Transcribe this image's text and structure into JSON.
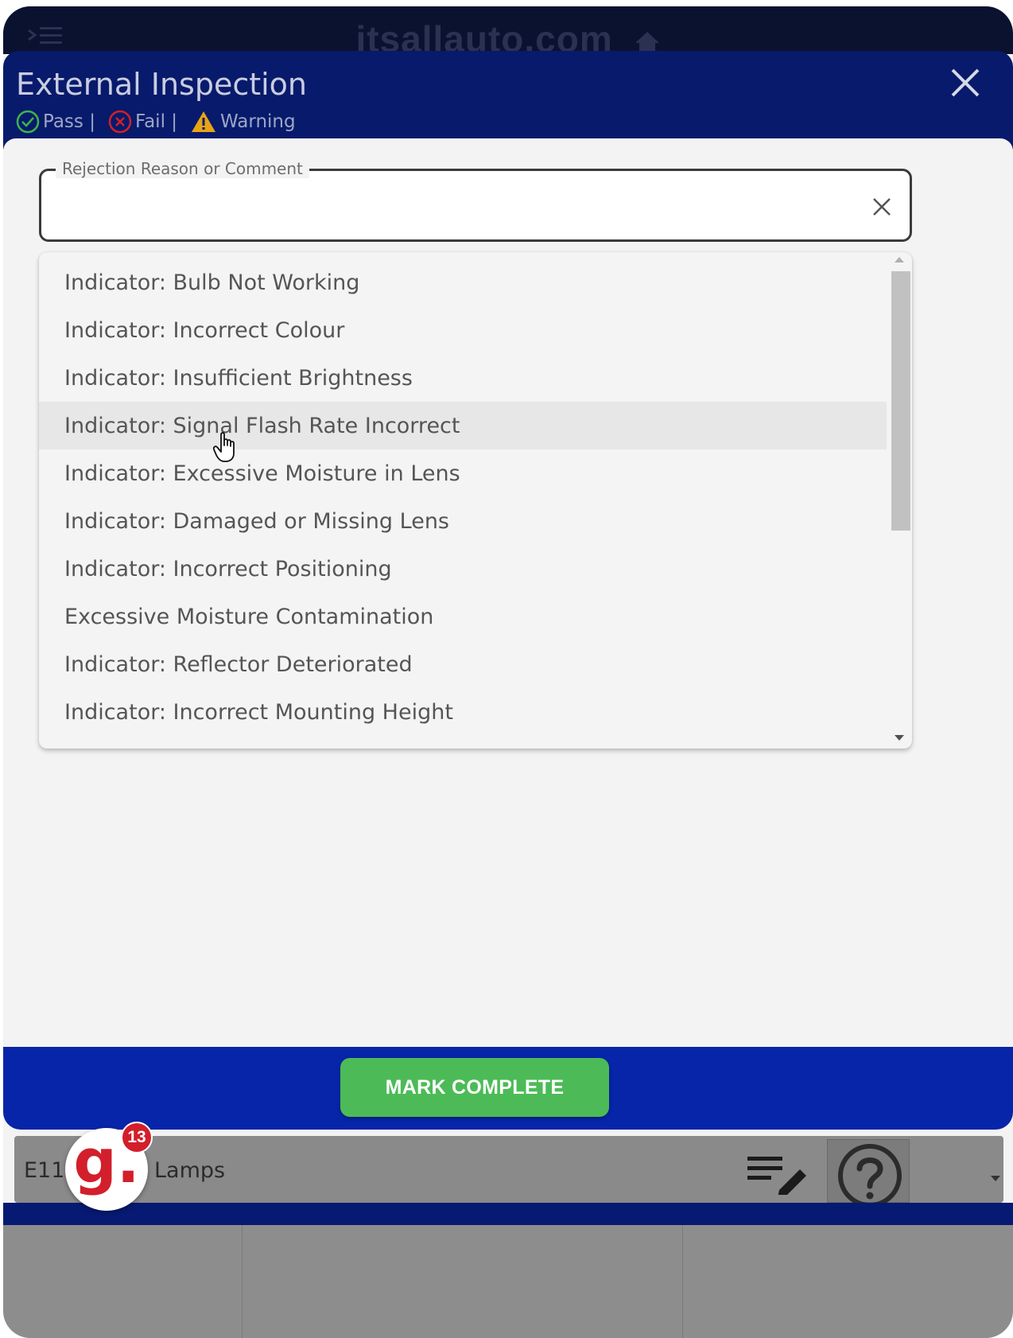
{
  "app": {
    "title": "itsallauto.com"
  },
  "modal": {
    "title": "External Inspection",
    "legend": {
      "pass": "Pass |",
      "fail": "Fail |",
      "warning": "Warning"
    }
  },
  "comment_field": {
    "label": "Rejection Reason or Comment",
    "value": ""
  },
  "options": [
    "Indicator: Bulb Not Working",
    "Indicator: Incorrect Colour",
    "Indicator: Insufficient Brightness",
    "Indicator: Signal Flash Rate Incorrect",
    "Indicator: Excessive Moisture in Lens",
    "Indicator: Damaged or Missing Lens",
    "Indicator: Incorrect Positioning",
    "Excessive Moisture Contamination",
    "Indicator: Reflector Deteriorated",
    "Indicator: Incorrect Mounting Height"
  ],
  "hovered_option": "Indicator: Signal Flash Rate Incorrect",
  "footer": {
    "mark_complete": "MARK COMPLETE"
  },
  "background_row": {
    "code": "E11.",
    "name": "Lamps"
  },
  "badge": {
    "letter": "g.",
    "count": "13"
  },
  "colors": {
    "header_bg": "#081a6b",
    "action_bar_bg": "#0625a8",
    "mark_complete_bg": "#4cbb57",
    "pass": "#3bb54a",
    "fail": "#d0202a",
    "warning": "#e8a317",
    "brand_red": "#d21f2b"
  },
  "icons": {
    "menu": "menu-icon",
    "home": "home-icon",
    "close": "close-icon",
    "pass": "check-circle-icon",
    "fail": "x-circle-icon",
    "warning": "warning-triangle-icon",
    "clear": "clear-icon",
    "edit_list": "edit-list-icon",
    "help": "help-icon"
  }
}
